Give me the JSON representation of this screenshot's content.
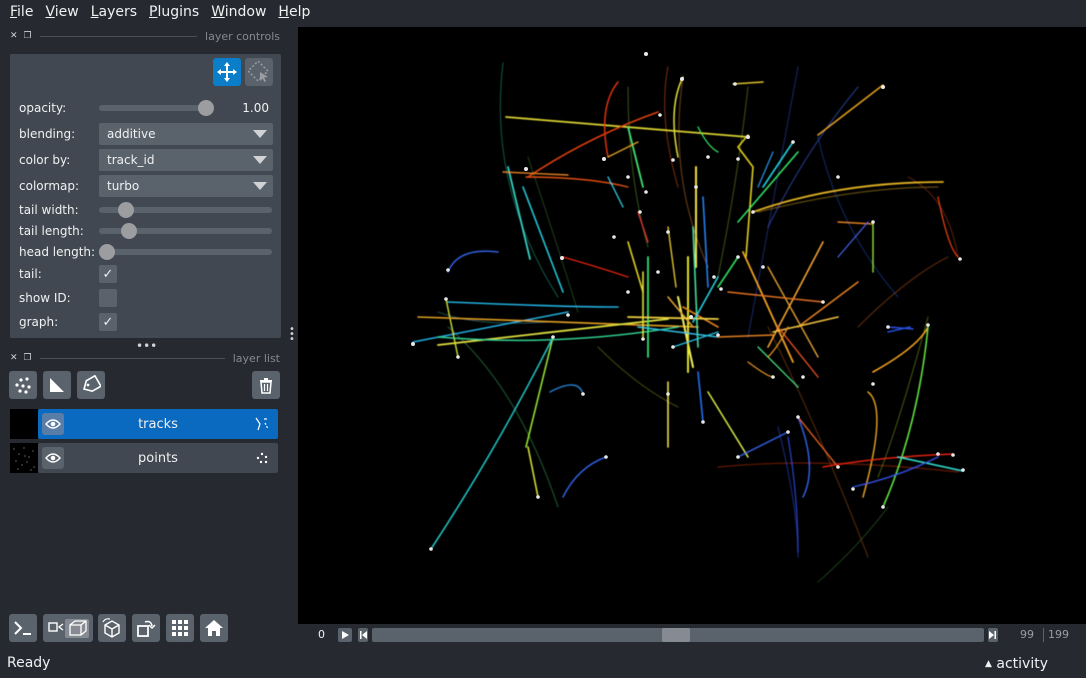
{
  "menu": [
    {
      "key": "F",
      "rest": "ile"
    },
    {
      "key": "V",
      "rest": "iew"
    },
    {
      "key": "L",
      "rest": "ayers"
    },
    {
      "key": "P",
      "rest": "lugins"
    },
    {
      "key": "W",
      "rest": "indow"
    },
    {
      "key": "H",
      "rest": "elp"
    }
  ],
  "layer_controls": {
    "title": "layer controls",
    "opacity_label": "opacity:",
    "opacity_value": "1.00",
    "opacity_fraction": 1.0,
    "blending_label": "blending:",
    "blending_value": "additive",
    "color_by_label": "color by:",
    "color_by_value": "track_id",
    "colormap_label": "colormap:",
    "colormap_value": "turbo",
    "tail_width_label": "tail width:",
    "tail_width_fraction": 0.12,
    "tail_length_label": "tail length:",
    "tail_length_fraction": 0.14,
    "head_length_label": "head length:",
    "head_length_fraction": 0.0,
    "tail_label": "tail:",
    "tail_checked": true,
    "show_id_label": "show ID:",
    "show_id_checked": false,
    "graph_label": "graph:",
    "graph_checked": true,
    "check_glyph": "✓"
  },
  "layer_list": {
    "title": "layer list",
    "layers": [
      {
        "name": "tracks",
        "selected": true,
        "type_icon": "tracks-icon"
      },
      {
        "name": "points",
        "selected": false,
        "type_icon": "points-icon"
      }
    ]
  },
  "dims": {
    "axis_label": "0",
    "current_frame": "99",
    "max_frame": "199"
  },
  "status": {
    "text": "Ready",
    "activity": "activity",
    "activity_arrow": "▲"
  },
  "colors": {
    "accent": "#0a7ec8",
    "selected_layer": "#0a6ac0",
    "panel": "#414851",
    "background": "#262930"
  }
}
